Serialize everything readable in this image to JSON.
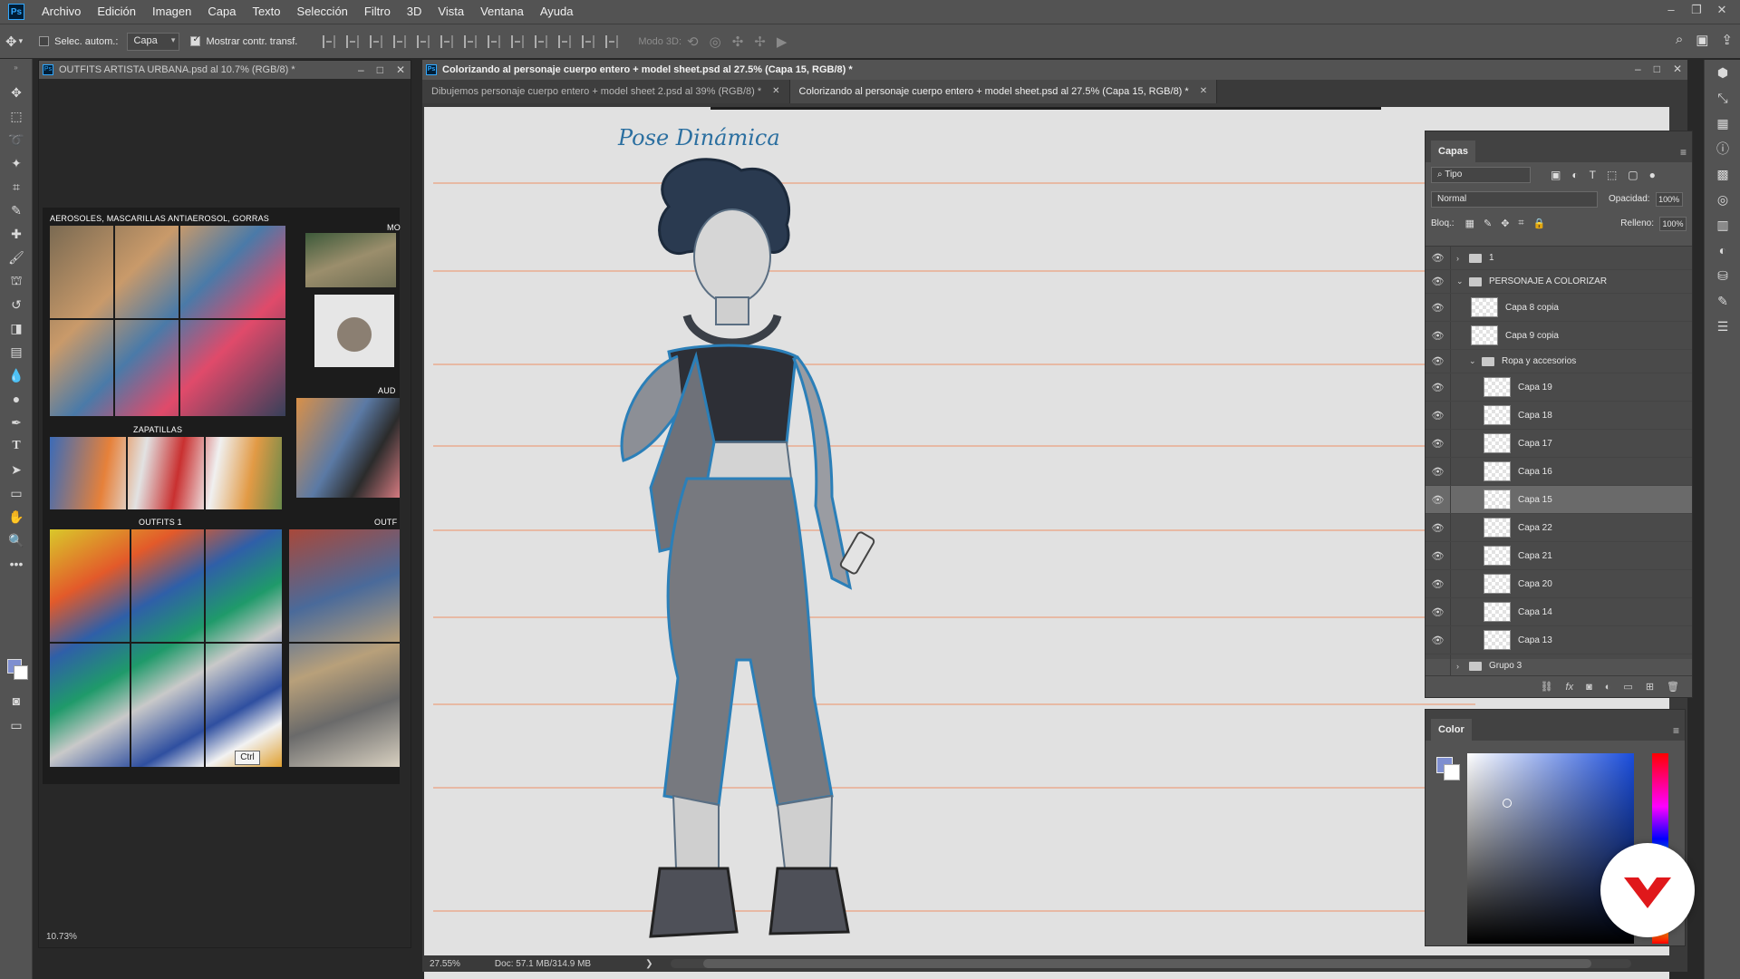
{
  "menu": [
    "Archivo",
    "Edición",
    "Imagen",
    "Capa",
    "Texto",
    "Selección",
    "Filtro",
    "3D",
    "Vista",
    "Ventana",
    "Ayuda"
  ],
  "options": {
    "auto_select_label": "Selec. autom.:",
    "auto_select_target": "Capa",
    "show_transform_label": "Mostrar contr. transf.",
    "mode3d_label": "Modo 3D:"
  },
  "left_doc": {
    "title": "OUTFITS ARTISTA URBANA.psd al 10.7% (RGB/8) *",
    "zoom": "10.73%",
    "collage_labels": {
      "aerosoles": "AEROSOLES, MASCARILLAS ANTIAEROSOL, GORRAS",
      "mo": "MO",
      "aud": "AUD",
      "zapatillas": "ZAPATILLAS",
      "outfits1": "OUTFITS 1",
      "outf": "OUTF"
    },
    "tooltip": "Ctrl"
  },
  "main_doc": {
    "title": "Colorizando al personaje cuerpo entero + model sheet.psd al 27.5% (Capa 15, RGB/8) *",
    "tabs": [
      {
        "label": "Dibujemos personaje cuerpo entero + model sheet 2.psd al 39% (RGB/8) *"
      },
      {
        "label": "Colorizando al personaje cuerpo entero + model sheet.psd al 27.5% (Capa 15, RGB/8) *"
      }
    ],
    "sketch_title": "Pose Dinámica",
    "zoom": "27.55%",
    "doc_info": "Doc: 57.1 MB/314.9 MB"
  },
  "layers_panel": {
    "tab": "Capas",
    "kind_filter": "Tipo",
    "blend_mode": "Normal",
    "opacity_label": "Opacidad:",
    "opacity": "100%",
    "lock_label": "Bloq.:",
    "fill_label": "Relleno:",
    "fill": "100%",
    "layers": [
      {
        "name": "1",
        "type": "group",
        "indent": 0,
        "collapsed": true
      },
      {
        "name": "PERSONAJE A COLORIZAR",
        "type": "group",
        "indent": 0,
        "collapsed": false
      },
      {
        "name": "Capa 8 copia",
        "type": "layer",
        "indent": 1
      },
      {
        "name": "Capa 9 copia",
        "type": "layer",
        "indent": 1
      },
      {
        "name": "Ropa y accesorios",
        "type": "group",
        "indent": 1,
        "collapsed": false
      },
      {
        "name": "Capa 19",
        "type": "layer",
        "indent": 2
      },
      {
        "name": "Capa 18",
        "type": "layer",
        "indent": 2
      },
      {
        "name": "Capa 17",
        "type": "layer",
        "indent": 2
      },
      {
        "name": "Capa 16",
        "type": "layer",
        "indent": 2
      },
      {
        "name": "Capa 15",
        "type": "layer",
        "indent": 2,
        "selected": true
      },
      {
        "name": "Capa 22",
        "type": "layer",
        "indent": 2
      },
      {
        "name": "Capa 21",
        "type": "layer",
        "indent": 2
      },
      {
        "name": "Capa 20",
        "type": "layer",
        "indent": 2
      },
      {
        "name": "Capa 14",
        "type": "layer",
        "indent": 2
      },
      {
        "name": "Capa 13",
        "type": "layer",
        "indent": 2
      },
      {
        "name": "Grupo 3",
        "type": "group",
        "indent": 0,
        "collapsed": true,
        "hidden": true
      }
    ]
  },
  "color_panel": {
    "tab": "Color",
    "foreground": "#7f8fd0",
    "background": "#ffffff"
  },
  "colors": {
    "ui_bg": "#535353",
    "canvas_bg": "#e1e1e1",
    "sketch_blue": "#2b7fb8",
    "guide_orange": "#e7b9a4",
    "watermark_red": "#e0181b"
  }
}
